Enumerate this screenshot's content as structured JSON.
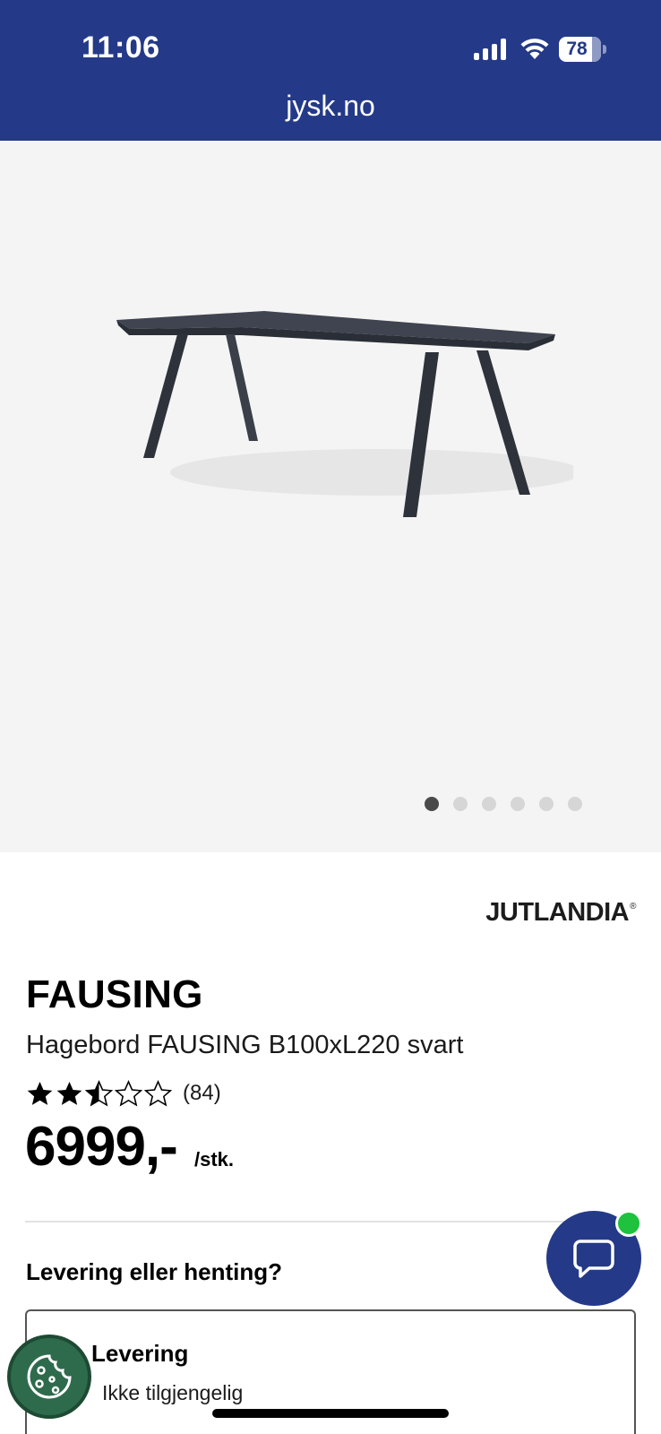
{
  "status_bar": {
    "time": "11:06",
    "battery_level": "78",
    "battery_percent": 78
  },
  "browser": {
    "url": "jysk.no"
  },
  "gallery": {
    "image_count": 6,
    "active_index": 0
  },
  "product": {
    "brand": "JUTLANDIA",
    "brand_mark": "®",
    "name": "FAUSING",
    "description": "Hagebord FAUSING B100xL220 svart",
    "rating_value": 2.5,
    "rating_max": 5,
    "rating_count": "(84)",
    "price": "6999,-",
    "price_unit": "/stk."
  },
  "delivery": {
    "question": "Levering eller henting?",
    "option_title": "Levering",
    "option_status": "Ikke tilgjengelig"
  },
  "colors": {
    "brand_blue": "#243a88",
    "online_green": "#1ec23d",
    "cookie_green": "#2e6b4c"
  },
  "icons": {
    "chat": "chat-bubble-icon",
    "cookie": "cookie-icon"
  }
}
